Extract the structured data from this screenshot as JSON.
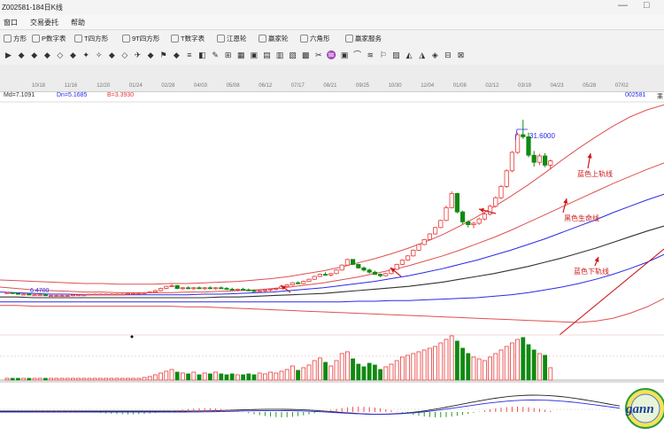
{
  "window": {
    "title": "Z002581-184日K线",
    "minimize_glyph": "—",
    "restore_glyph": "□"
  },
  "menu": [
    "窗口",
    "交易委托",
    "帮助"
  ],
  "toolbar": [
    {
      "label": "方形",
      "icon": "square-icon"
    },
    {
      "label": "P数字表",
      "icon": "p-table-icon"
    },
    {
      "label": "T四方形",
      "icon": "t-square-icon"
    },
    {
      "label": "9T四方形",
      "icon": "9t-square-icon"
    },
    {
      "label": "T数字表",
      "icon": "t-table-icon"
    },
    {
      "label": "江恩轮",
      "icon": "gann-wheel-icon"
    },
    {
      "label": "赢家轮",
      "icon": "winner-wheel-icon"
    },
    {
      "label": "六角形",
      "icon": "hexagon-icon"
    },
    {
      "label": "赢家服务",
      "icon": "service-icon"
    }
  ],
  "drawing_tools": [
    "▶",
    "◆",
    "◆",
    "◆",
    "◇",
    "◆",
    "✦",
    "✧",
    "◆",
    "◇",
    "✈",
    "◆",
    "⚑",
    "◆",
    "≡",
    "◧",
    "✎",
    "⊞",
    "▦",
    "▣",
    "▤",
    "▥",
    "▧",
    "▩",
    "✂",
    "♒",
    "▣",
    "⌒",
    "≋",
    "⚐",
    "▨",
    "◭",
    "◮",
    "◈",
    "⊟",
    "⊠"
  ],
  "date_ticks": [
    "10/18",
    "11/16",
    "12/20",
    "01/24",
    "02/28",
    "04/03",
    "05/08",
    "06/12",
    "07/17",
    "08/21",
    "09/25",
    "10/30",
    "12/04",
    "01/08",
    "02/12",
    "03/19",
    "04/23",
    "05/28",
    "07/02"
  ],
  "indicators": {
    "md": "Md=7.1091",
    "dn": "Dn=5.1685",
    "b": "B=3.3930",
    "code": "002581",
    "edge": "乘"
  },
  "annotations": {
    "high_label": "31.6000",
    "low_label": "6.4700",
    "upper_band": "蓝色上轨线",
    "middle_band": "黑色生命线",
    "lower_band": "蓝色下轨线"
  },
  "logo_text": "gann",
  "colors": {
    "up": "#e83a3a",
    "down": "#108a10",
    "blue_line": "#2a2ae8",
    "black_line": "#333333",
    "red_band": "#e05050",
    "annotation": "#d01818"
  },
  "chart_data": {
    "type": "candlestick",
    "price_labels": {
      "high": 31.6,
      "low": 6.47
    },
    "series": [
      {
        "values": [
          8,
          7.8,
          7.6,
          7.5,
          7.4,
          7.3,
          7.3,
          7.2,
          7.2,
          7.2,
          7.2,
          7.3,
          7.3,
          7.4,
          7.5,
          7.6,
          7.8,
          8,
          8.3,
          8.6,
          9,
          9.4,
          9.9,
          10.4,
          11,
          11.7,
          12.4,
          13.2,
          14.1,
          15,
          16,
          17.1,
          18.2,
          19.3,
          20.4,
          21.5,
          22.6,
          23.6,
          24.6,
          25.5
        ]
      },
      {
        "values": [
          7.3,
          7.2,
          7.1,
          7,
          7,
          6.9,
          6.9,
          6.9,
          6.9,
          6.9,
          6.9,
          6.9,
          7,
          7,
          7.1,
          7.2,
          7.3,
          7.5,
          7.7,
          7.9,
          8.2,
          8.5,
          8.8,
          9.2,
          9.6,
          10.1,
          10.6,
          11.2,
          11.8,
          12.5,
          13.2,
          14,
          14.8,
          15.7,
          16.6,
          17.5,
          18.5,
          19.4,
          20.3,
          21.1
        ]
      },
      {
        "values": [
          6.6,
          6.6,
          6.5,
          6.5,
          6.5,
          6.5,
          6.5,
          6.5,
          6.5,
          6.5,
          6.5,
          6.5,
          6.5,
          6.6,
          6.6,
          6.7,
          6.8,
          6.9,
          7,
          7.1,
          7.3,
          7.5,
          7.7,
          7.9,
          8.1,
          8.4,
          8.7,
          9.1,
          9.5,
          9.9,
          10.4,
          10.9,
          11.5,
          12.1,
          12.8,
          13.5,
          14.3,
          15.1,
          15.9,
          16.6
        ]
      },
      {
        "values": [
          5.9,
          5.9,
          5.9,
          5.9,
          5.9,
          5.9,
          5.9,
          5.9,
          5.9,
          5.9,
          5.9,
          5.9,
          5.9,
          5.9,
          5.9,
          5.9,
          5.9,
          5.9,
          5.9,
          5.9,
          5.9,
          6,
          6,
          6.1,
          6.1,
          6.2,
          6.3,
          6.4,
          6.5,
          6.7,
          6.9,
          7.2,
          7.6,
          8,
          8.5,
          9.1,
          9.8,
          10.6,
          11.5,
          12.6
        ]
      },
      {
        "values": [
          9,
          8.9,
          8.8,
          8.7,
          8.6,
          8.5,
          8.5,
          8.4,
          8.4,
          8.4,
          8.5,
          8.5,
          8.6,
          8.7,
          8.8,
          9,
          9.2,
          9.5,
          9.9,
          10.3,
          10.8,
          11.4,
          12,
          12.7,
          13.5,
          14.4,
          15.4,
          16.6,
          17.9,
          19.3,
          20.8,
          22.4,
          24.1,
          25.9,
          27.6,
          29.2,
          30.7,
          32,
          33,
          33.7
        ]
      },
      {
        "values": [
          5.4,
          5.4,
          5.3,
          5.3,
          5.3,
          5.3,
          5.3,
          5.3,
          5.3,
          5.3,
          5.3,
          5.2,
          5.2,
          5.1,
          5,
          4.9,
          4.8,
          4.7,
          4.6,
          4.5,
          4.4,
          4.3,
          4.2,
          4.1,
          4,
          3.9,
          3.8,
          3.7,
          3.6,
          3.5,
          3.4,
          3.3,
          3.2,
          3.1,
          3,
          3.2,
          3.6,
          4.3,
          5.2,
          6.4
        ]
      }
    ],
    "ohlc": [
      [
        7.2,
        7.3,
        7.1,
        7.2
      ],
      [
        7.2,
        7.3,
        7.1,
        7.1
      ],
      [
        7.1,
        7.2,
        7,
        7.0
      ],
      [
        7.0,
        7.1,
        6.9,
        7.0
      ],
      [
        7.0,
        7.1,
        6.9,
        6.9
      ],
      [
        6.9,
        7.0,
        6.8,
        6.9
      ],
      [
        6.9,
        7.0,
        6.8,
        6.9
      ],
      [
        6.9,
        7.0,
        6.8,
        6.8
      ],
      [
        6.8,
        6.9,
        6.7,
        6.8
      ],
      [
        6.8,
        6.9,
        6.7,
        6.8
      ],
      [
        6.8,
        6.9,
        6.7,
        6.8
      ],
      [
        6.8,
        6.9,
        6.7,
        6.8
      ],
      [
        6.8,
        6.9,
        6.7,
        6.9
      ],
      [
        6.9,
        7.0,
        6.8,
        6.9
      ],
      [
        6.9,
        7.0,
        6.8,
        6.9
      ],
      [
        6.9,
        7.0,
        6.8,
        7.0
      ],
      [
        7.0,
        7.1,
        6.9,
        7.0
      ],
      [
        7.0,
        7.1,
        6.9,
        7.0
      ],
      [
        7.0,
        7.1,
        6.9,
        7.0
      ],
      [
        7.0,
        7.1,
        6.9,
        7.0
      ],
      [
        7.0,
        7.1,
        6.9,
        7.0
      ],
      [
        7.0,
        7.1,
        6.9,
        7.0
      ],
      [
        7.0,
        7.2,
        6.9,
        7.1
      ],
      [
        7.1,
        7.2,
        7.0,
        7.1
      ],
      [
        7.1,
        7.2,
        7.0,
        7.1
      ],
      [
        7.1,
        7.3,
        7.0,
        7.2
      ],
      [
        7.2,
        7.4,
        7.1,
        7.3
      ],
      [
        7.3,
        7.6,
        7.2,
        7.5
      ],
      [
        7.5,
        7.9,
        7.4,
        7.8
      ],
      [
        7.8,
        8.2,
        7.7,
        8.1
      ],
      [
        8.1,
        8.4,
        8.0,
        8.2
      ],
      [
        8.2,
        8.3,
        7.7,
        7.8
      ],
      [
        7.8,
        8.0,
        7.6,
        7.9
      ],
      [
        7.9,
        8.1,
        7.7,
        7.8
      ],
      [
        7.8,
        8.0,
        7.6,
        7.9
      ],
      [
        7.9,
        8.1,
        7.7,
        7.8
      ],
      [
        7.8,
        8.0,
        7.6,
        7.9
      ],
      [
        7.9,
        8.1,
        7.7,
        7.8
      ],
      [
        7.8,
        8.0,
        7.6,
        7.9
      ],
      [
        7.9,
        8.1,
        7.7,
        7.8
      ],
      [
        7.8,
        8.0,
        7.6,
        7.7
      ],
      [
        7.7,
        7.9,
        7.5,
        7.6
      ],
      [
        7.6,
        7.8,
        7.4,
        7.7
      ],
      [
        7.7,
        7.9,
        7.5,
        7.6
      ],
      [
        7.6,
        7.8,
        7.4,
        7.5
      ],
      [
        7.5,
        7.7,
        7.3,
        7.4
      ],
      [
        7.4,
        7.6,
        7.2,
        7.5
      ],
      [
        7.5,
        7.7,
        7.3,
        7.6
      ],
      [
        7.6,
        7.8,
        7.4,
        7.7
      ],
      [
        7.7,
        7.9,
        7.5,
        7.8
      ],
      [
        7.8,
        8.2,
        7.7,
        8.1
      ],
      [
        8.1,
        8.4,
        8.0,
        8.3
      ],
      [
        8.3,
        8.7,
        8.2,
        8.6
      ],
      [
        8.6,
        8.8,
        8.4,
        8.5
      ],
      [
        8.5,
        8.9,
        8.4,
        8.8
      ],
      [
        8.8,
        9.2,
        8.7,
        9.1
      ],
      [
        9.1,
        9.6,
        9.0,
        9.5
      ],
      [
        9.5,
        9.9,
        9.4,
        9.8
      ],
      [
        9.8,
        10.1,
        9.6,
        9.7
      ],
      [
        9.7,
        10.0,
        9.5,
        9.9
      ],
      [
        9.9,
        10.5,
        9.8,
        10.4
      ],
      [
        10.4,
        11.2,
        10.3,
        11.1
      ],
      [
        11.1,
        12.0,
        11.0,
        11.9
      ],
      [
        11.9,
        11.9,
        11.1,
        11.2
      ],
      [
        11.2,
        11.3,
        10.6,
        10.7
      ],
      [
        10.7,
        10.9,
        10.2,
        10.4
      ],
      [
        10.4,
        10.6,
        9.9,
        10.1
      ],
      [
        10.1,
        10.3,
        9.7,
        9.8
      ],
      [
        9.8,
        9.9,
        9.4,
        9.6
      ],
      [
        9.6,
        10.0,
        9.5,
        9.9
      ],
      [
        9.9,
        10.6,
        9.8,
        10.5
      ],
      [
        10.5,
        11.3,
        10.4,
        11.2
      ],
      [
        11.2,
        11.9,
        11.1,
        11.8
      ],
      [
        11.8,
        12.5,
        11.7,
        12.4
      ],
      [
        12.4,
        13.3,
        12.3,
        13.2
      ],
      [
        13.2,
        14.1,
        13.1,
        14.0
      ],
      [
        14.0,
        14.8,
        13.9,
        14.7
      ],
      [
        14.7,
        15.6,
        14.6,
        15.5
      ],
      [
        15.5,
        16.5,
        15.4,
        16.4
      ],
      [
        16.4,
        17.5,
        16.3,
        17.4
      ],
      [
        17.4,
        19.5,
        17.3,
        19.2
      ],
      [
        19.2,
        21.5,
        19.1,
        21.2
      ],
      [
        21.2,
        21.3,
        18.4,
        18.6
      ],
      [
        18.6,
        18.8,
        16.9,
        17.2
      ],
      [
        17.2,
        17.4,
        16.4,
        16.8
      ],
      [
        16.8,
        17.2,
        16.3,
        17.0
      ],
      [
        17.0,
        17.8,
        16.8,
        17.6
      ],
      [
        17.6,
        18.5,
        17.4,
        18.3
      ],
      [
        18.3,
        19.6,
        18.1,
        19.4
      ],
      [
        19.4,
        20.8,
        19.2,
        20.6
      ],
      [
        20.6,
        22.4,
        20.4,
        22.2
      ],
      [
        22.2,
        24.6,
        22.0,
        24.4
      ],
      [
        24.4,
        27.2,
        24.2,
        27.0
      ],
      [
        27.0,
        29.8,
        26.8,
        29.5
      ],
      [
        29.5,
        31.6,
        28.9,
        29.2
      ],
      [
        29.2,
        29.8,
        26.3,
        26.6
      ],
      [
        26.6,
        27.2,
        25.0,
        25.6
      ],
      [
        25.6,
        26.8,
        25.2,
        26.5
      ],
      [
        26.5,
        26.9,
        24.9,
        25.2
      ],
      [
        25.2,
        26.0,
        24.6,
        25.8
      ]
    ],
    "volume": [
      1,
      1,
      1,
      1,
      1,
      1,
      1,
      1,
      1,
      1,
      1,
      1,
      1,
      1,
      1,
      1,
      1,
      1,
      1,
      1,
      1,
      1,
      1,
      1,
      1,
      1,
      1,
      1,
      1,
      1,
      1,
      1,
      1,
      1,
      1,
      1,
      1,
      1,
      1,
      1,
      1,
      1,
      1,
      1,
      1,
      1,
      1,
      1,
      1,
      1,
      1,
      1,
      1,
      1,
      1,
      1,
      1,
      1,
      1,
      1,
      1,
      1,
      1,
      1,
      1,
      1,
      1,
      1,
      1,
      1,
      1,
      1,
      1,
      1,
      1,
      1,
      1,
      1,
      1,
      1,
      1,
      1,
      1,
      1,
      1,
      1,
      1,
      1,
      1,
      1,
      1,
      1,
      1,
      1,
      1,
      1,
      1,
      1,
      1,
      1
    ]
  }
}
